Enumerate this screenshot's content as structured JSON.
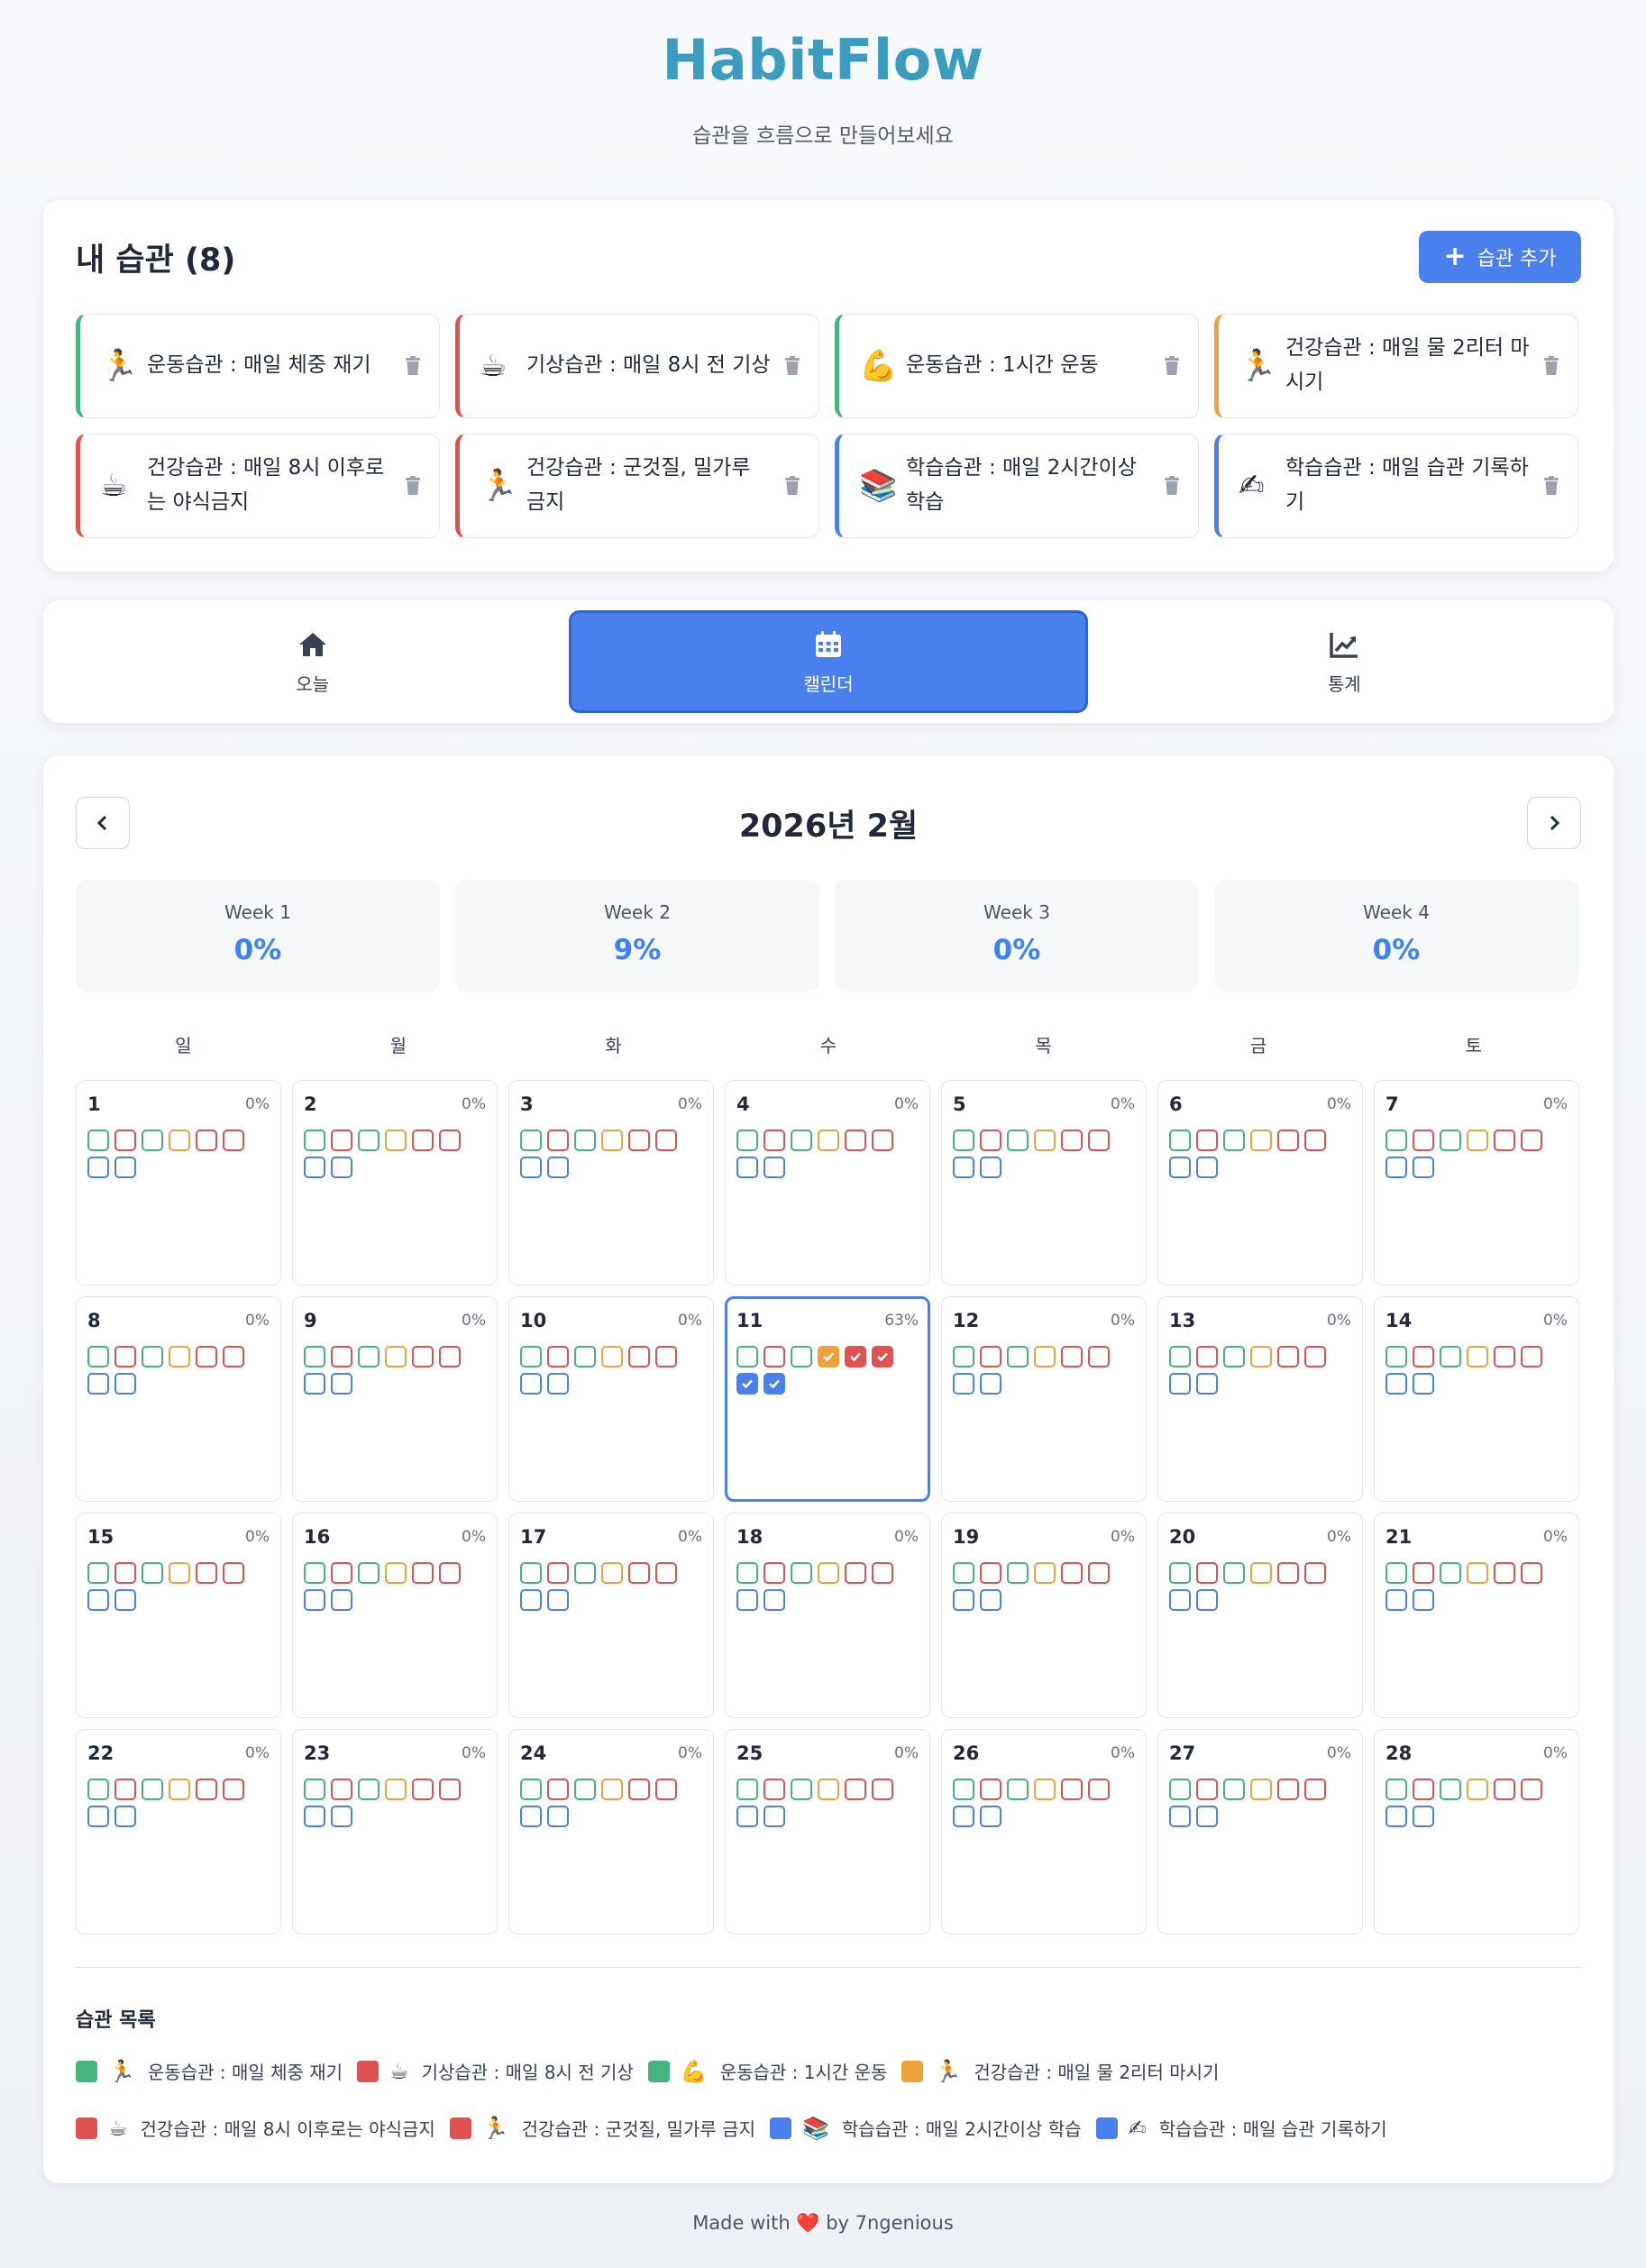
{
  "app": {
    "title": "HabitFlow",
    "subtitle": "습관을 흐름으로 만들어보세요"
  },
  "habits": {
    "title": "내 습관 (8)",
    "add_label": "습관 추가",
    "items": [
      {
        "name": "운동습관 : 매일 체중 재기",
        "emoji": "🏃",
        "color": "#46b47e"
      },
      {
        "name": "기상습관 : 매일 8시 전 기상",
        "emoji": "☕",
        "color": "#e05252"
      },
      {
        "name": "운동습관 : 1시간 운동",
        "emoji": "💪",
        "color": "#46b47e"
      },
      {
        "name": "건강습관 : 매일 물 2리터 마시기",
        "emoji": "🏃",
        "color": "#eda23a"
      },
      {
        "name": "건강습관 : 매일 8시 이후로는 야식금지",
        "emoji": "☕",
        "color": "#e05252"
      },
      {
        "name": "건강습관 : 군것질, 밀가루 금지",
        "emoji": "🏃",
        "color": "#e05252"
      },
      {
        "name": "학습습관 : 매일 2시간이상 학습",
        "emoji": "📚",
        "color": "#4a80ee"
      },
      {
        "name": "학습습관 : 매일 습관 기록하기",
        "emoji": "✍",
        "color": "#4a80ee"
      }
    ]
  },
  "tabs": [
    {
      "label": "오늘",
      "icon": "home-icon"
    },
    {
      "label": "캘린더",
      "icon": "calendar-icon"
    },
    {
      "label": "통계",
      "icon": "chart-icon"
    }
  ],
  "calendar": {
    "month_title": "2026년 2월",
    "weeks": [
      {
        "label": "Week 1",
        "pct": "0%"
      },
      {
        "label": "Week 2",
        "pct": "9%"
      },
      {
        "label": "Week 3",
        "pct": "0%"
      },
      {
        "label": "Week 4",
        "pct": "0%"
      }
    ],
    "weekdays": [
      "일",
      "월",
      "화",
      "수",
      "목",
      "금",
      "토"
    ],
    "today": 11,
    "days": [
      {
        "num": "1",
        "pct": "0%",
        "checked": []
      },
      {
        "num": "2",
        "pct": "0%",
        "checked": []
      },
      {
        "num": "3",
        "pct": "0%",
        "checked": []
      },
      {
        "num": "4",
        "pct": "0%",
        "checked": []
      },
      {
        "num": "5",
        "pct": "0%",
        "checked": []
      },
      {
        "num": "6",
        "pct": "0%",
        "checked": []
      },
      {
        "num": "7",
        "pct": "0%",
        "checked": []
      },
      {
        "num": "8",
        "pct": "0%",
        "checked": []
      },
      {
        "num": "9",
        "pct": "0%",
        "checked": []
      },
      {
        "num": "10",
        "pct": "0%",
        "checked": []
      },
      {
        "num": "11",
        "pct": "63%",
        "checked": [
          3,
          4,
          5,
          6,
          7
        ]
      },
      {
        "num": "12",
        "pct": "0%",
        "checked": []
      },
      {
        "num": "13",
        "pct": "0%",
        "checked": []
      },
      {
        "num": "14",
        "pct": "0%",
        "checked": []
      },
      {
        "num": "15",
        "pct": "0%",
        "checked": []
      },
      {
        "num": "16",
        "pct": "0%",
        "checked": []
      },
      {
        "num": "17",
        "pct": "0%",
        "checked": []
      },
      {
        "num": "18",
        "pct": "0%",
        "checked": []
      },
      {
        "num": "19",
        "pct": "0%",
        "checked": []
      },
      {
        "num": "20",
        "pct": "0%",
        "checked": []
      },
      {
        "num": "21",
        "pct": "0%",
        "checked": []
      },
      {
        "num": "22",
        "pct": "0%",
        "checked": []
      },
      {
        "num": "23",
        "pct": "0%",
        "checked": []
      },
      {
        "num": "24",
        "pct": "0%",
        "checked": []
      },
      {
        "num": "25",
        "pct": "0%",
        "checked": []
      },
      {
        "num": "26",
        "pct": "0%",
        "checked": []
      },
      {
        "num": "27",
        "pct": "0%",
        "checked": []
      },
      {
        "num": "28",
        "pct": "0%",
        "checked": []
      }
    ]
  },
  "legend": {
    "title": "습관 목록",
    "items": [
      {
        "label": "운동습관 : 매일 체중 재기"
      },
      {
        "label": "기상습관 : 매일 8시 전 기상"
      },
      {
        "label": "운동습관 : 1시간 운동"
      },
      {
        "label": "건강습관 : 매일 물 2리터 마시기"
      },
      {
        "label": "건강습관 : 매일 8시 이후로는 야식금지"
      },
      {
        "label": "건강습관 : 군것질, 밀가루 금지"
      },
      {
        "label": "학습습관 : 매일 2시간이상 학습"
      },
      {
        "label": "학습습관 : 매일 습관 기록하기"
      }
    ]
  },
  "footer": {
    "prefix": "Made with",
    "heart": "❤️",
    "suffix": "by 7ngenious"
  }
}
